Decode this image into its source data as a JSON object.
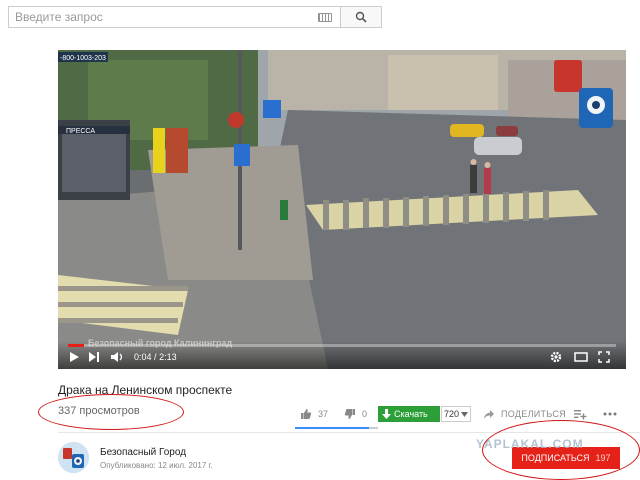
{
  "search": {
    "placeholder": "Введите запрос",
    "keyboard_icon": "keyboard-icon",
    "search_icon": "search-icon"
  },
  "video": {
    "overlay_phone": "-800-1003-203",
    "store_sign": "ПРЕССА",
    "caption_overlay": "Безопасный город Калининград",
    "current_time": "0:04",
    "duration": "2:13",
    "time_separator": "/",
    "progress": 0.03,
    "icons": [
      "play-icon",
      "next-icon",
      "volume-icon",
      "settings-icon",
      "theater-icon",
      "fullscreen-icon"
    ]
  },
  "meta": {
    "title": "Драка на Ленинском проспекте",
    "views": "337 просмотров"
  },
  "actions": {
    "likes": "37",
    "dislikes": "0",
    "download_label": "Скачать",
    "quality": "720",
    "share_label": "ПОДЕЛИТЬСЯ"
  },
  "channel": {
    "name": "Безопасный Город",
    "published": "Опубликовано: 12 июл. 2017 г.",
    "subscribe_label": "ПОДПИСАТЬСЯ",
    "subscribers": "197"
  },
  "watermark": "YAPLAKAL.COM",
  "colors": {
    "accent_red": "#e62117",
    "download_green": "#2c9f39",
    "like_blue": "#3d8df6",
    "annotation_red": "#d01414"
  }
}
